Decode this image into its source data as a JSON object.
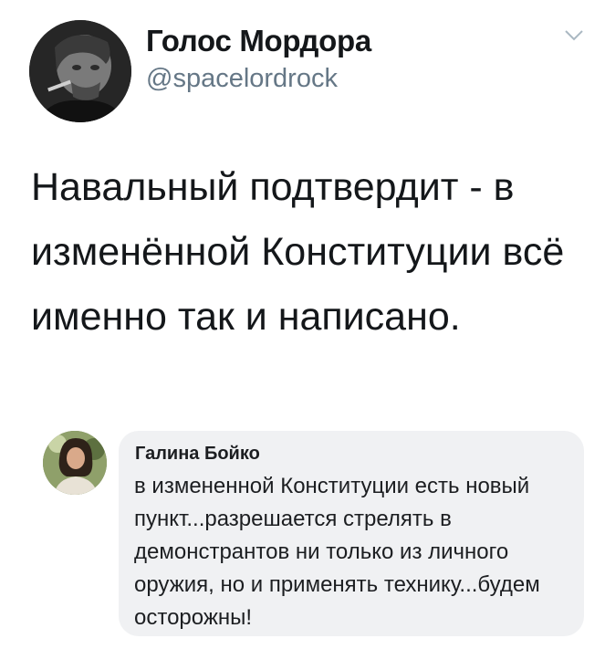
{
  "tweet": {
    "author": {
      "display_name": "Голос Мордора",
      "handle": "@spacelordrock",
      "avatar_icon": "user-avatar-photo"
    },
    "menu_icon": "chevron-down-icon",
    "text": "Навальный подтвердит - в изменённой Конституции всё именно так и написано."
  },
  "reply": {
    "author": {
      "display_name": "Галина Бойко",
      "avatar_icon": "user-avatar-photo"
    },
    "text": "в измененной Конституции есть новый пункт...разрешается стрелять в демонстрантов ни только из личного оружия, но и применять технику...будем осторожны!"
  },
  "colors": {
    "text_primary": "#14171a",
    "text_secondary": "#657786",
    "bubble_background": "#f0f1f3"
  }
}
